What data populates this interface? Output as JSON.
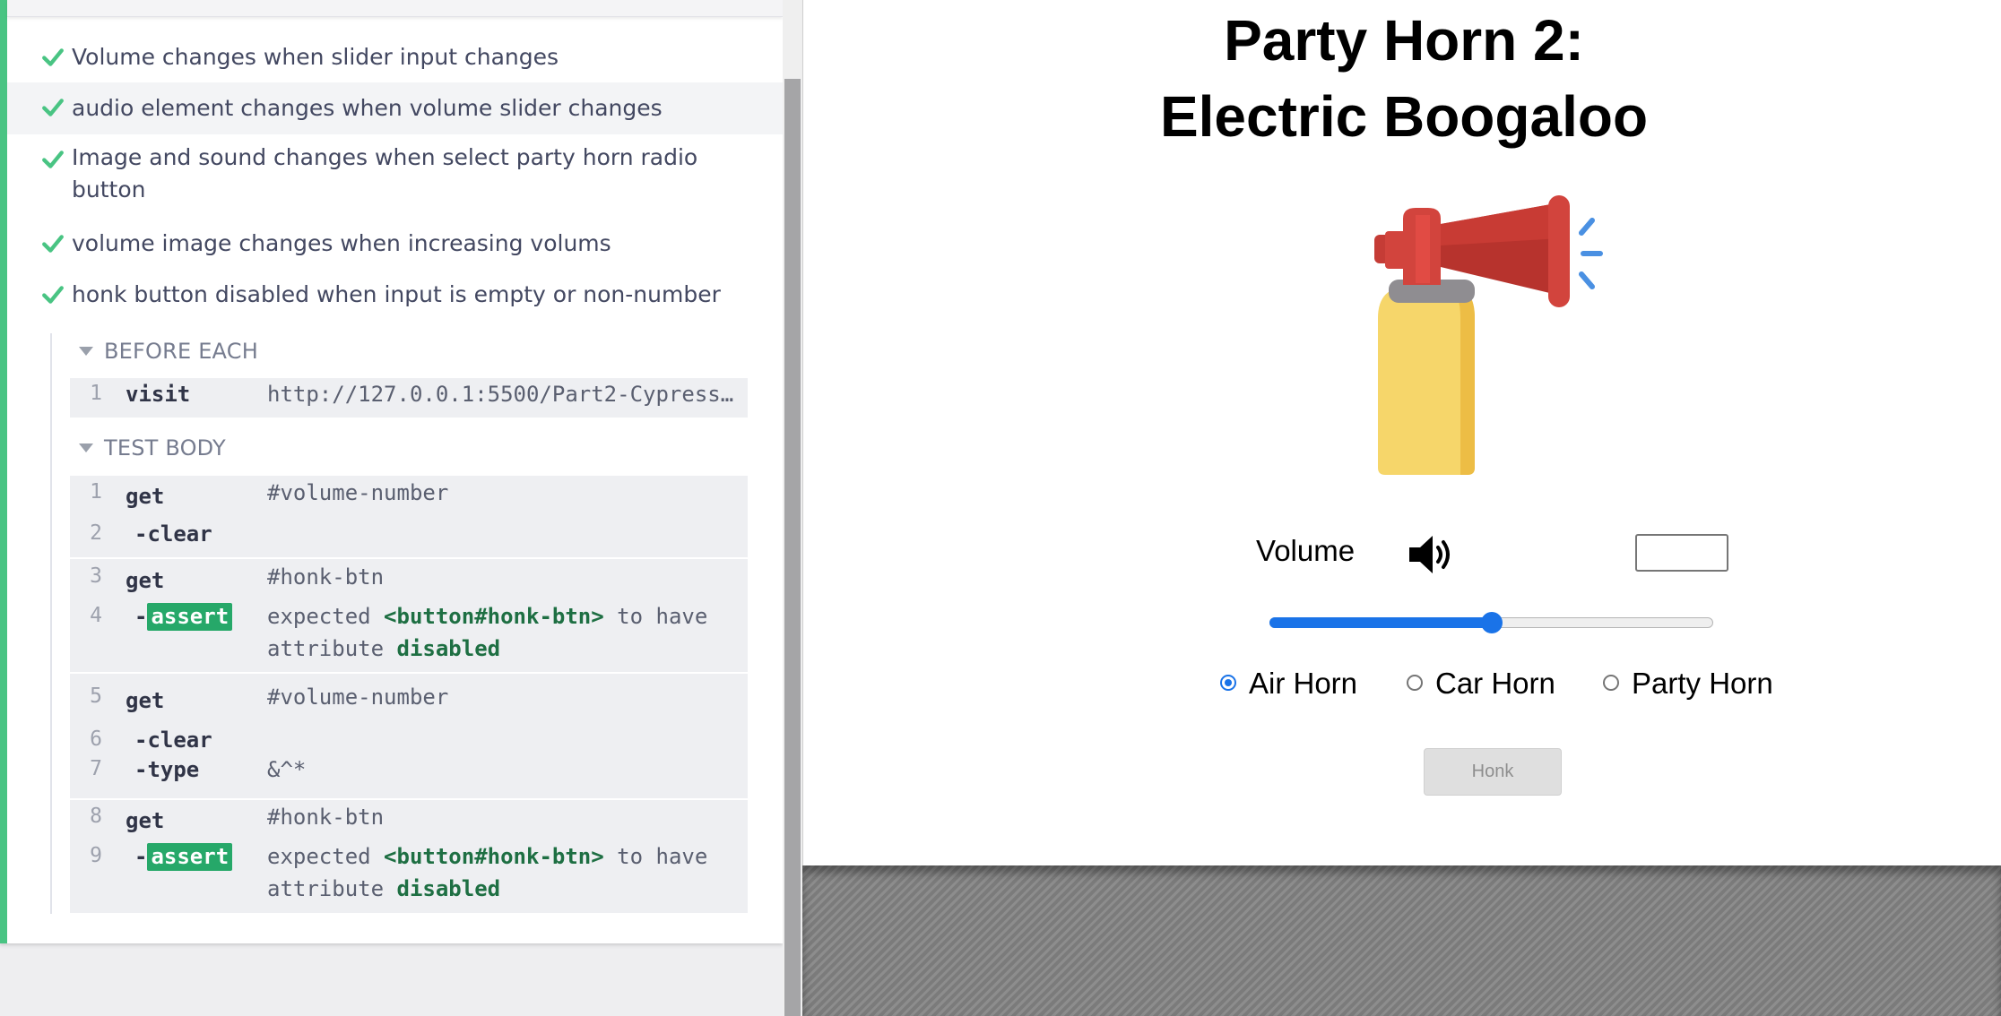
{
  "reporter": {
    "tests": [
      {
        "title": "Volume changes when slider input changes",
        "status": "passed"
      },
      {
        "title": "audio element changes when volume slider changes",
        "status": "passed"
      },
      {
        "title": "Image and sound changes when select party horn radio button",
        "status": "passed"
      },
      {
        "title": "volume image changes when increasing volums",
        "status": "passed"
      },
      {
        "title": "honk button disabled when input is empty or non-number",
        "status": "passed"
      }
    ],
    "before_each": {
      "label": "BEFORE EACH",
      "commands": [
        {
          "num": "1",
          "name": "visit",
          "message": "http://127.0.0.1:5500/Part2-Cypress…"
        }
      ]
    },
    "test_body": {
      "label": "TEST BODY",
      "commands": [
        {
          "num": "1",
          "name": "get",
          "message": "#volume-number"
        },
        {
          "num": "2",
          "name": "-clear",
          "message": ""
        },
        {
          "num": "3",
          "name": "get",
          "message": "#honk-btn"
        },
        {
          "num": "4",
          "name": "assert",
          "prefix": "-",
          "message_parts": [
            "expected",
            "<button#honk-btn>",
            "to have",
            "attribute",
            "disabled"
          ]
        },
        {
          "num": "5",
          "name": "get",
          "message": "#volume-number"
        },
        {
          "num": "6",
          "name": "-clear",
          "message": ""
        },
        {
          "num": "7",
          "name": "-type",
          "message": "&^*"
        },
        {
          "num": "8",
          "name": "get",
          "message": "#honk-btn"
        },
        {
          "num": "9",
          "name": "assert",
          "prefix": "-",
          "message_parts": [
            "expected",
            "<button#honk-btn>",
            "to have",
            "attribute",
            "disabled"
          ]
        }
      ]
    },
    "colors": {
      "pass": "#49c483",
      "assert_badge": "#26a869"
    }
  },
  "app": {
    "title_line1": "Party Horn 2:",
    "title_line2": "Electric Boogaloo",
    "image": "air-horn-icon",
    "volume_label": "Volume",
    "volume_icon": "speaker-volume-icon",
    "volume_number_value": "",
    "slider_value": 50,
    "radios": [
      {
        "label": "Air Horn",
        "checked": true
      },
      {
        "label": "Car Horn",
        "checked": false
      },
      {
        "label": "Party Horn",
        "checked": false
      }
    ],
    "honk_label": "Honk",
    "honk_disabled": true,
    "accent": "#1a73e8"
  }
}
